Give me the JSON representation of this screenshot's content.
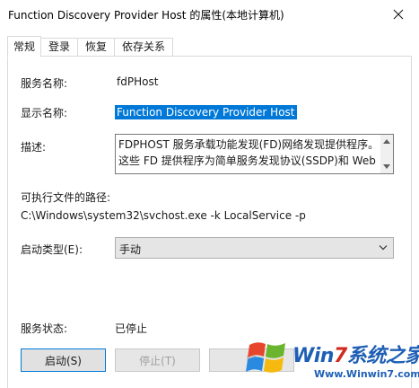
{
  "window": {
    "title": "Function Discovery Provider Host 的属性(本地计算机)"
  },
  "tabs": [
    {
      "label": "常规",
      "active": true
    },
    {
      "label": "登录",
      "active": false
    },
    {
      "label": "恢复",
      "active": false
    },
    {
      "label": "依存关系",
      "active": false
    }
  ],
  "general": {
    "service_name_label": "服务名称:",
    "service_name_value": "fdPHost",
    "display_name_label": "显示名称:",
    "display_name_value": "Function Discovery Provider Host",
    "description_label": "描述:",
    "description_lines": [
      "FDPHOST 服务承载功能发现(FD)网络发现提供程序。",
      "这些 FD 提供程序为简单服务发现协议(SSDP)和 Web"
    ],
    "path_label": "可执行文件的路径:",
    "path_value": "C:\\Windows\\system32\\svchost.exe -k LocalService -p",
    "startup_type_label": "启动类型(E):",
    "startup_type_value": "手动",
    "status_label": "服务状态:",
    "status_value": "已停止"
  },
  "buttons": {
    "start": "启动(S)",
    "stop": "停止(T)",
    "pause": "暂"
  },
  "watermark": {
    "brand_prefix": "Win",
    "brand_digit": "7",
    "brand_suffix": "系统之家",
    "url": "Www.Winwin7.com"
  },
  "icons": {
    "close": "close-icon",
    "dropdown": "chevron-down-icon",
    "scroll_up": "arrow-up-icon",
    "scroll_down": "arrow-down-icon",
    "logo": "windows-flag-icon"
  },
  "colors": {
    "selection": "#0078d7",
    "button_face": "#e1e1e1",
    "select_face": "#e5e5e5"
  }
}
